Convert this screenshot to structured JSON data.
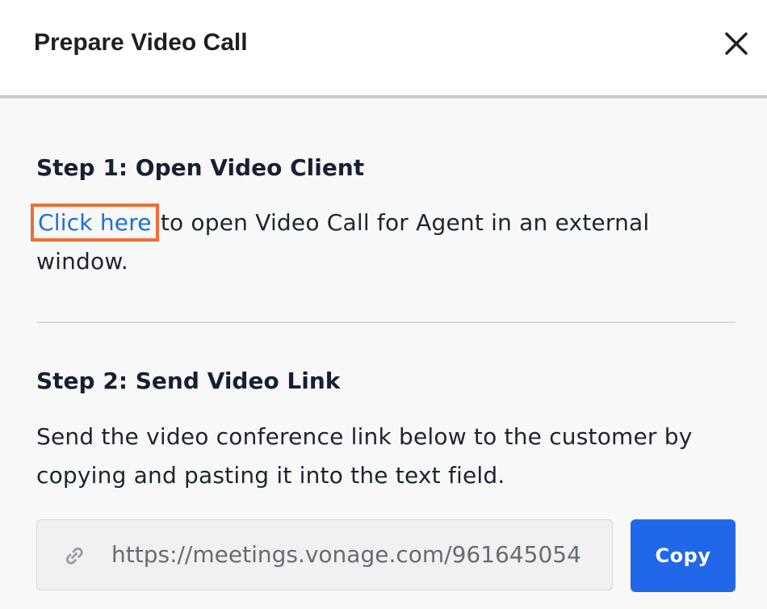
{
  "header": {
    "title": "Prepare Video Call",
    "close_icon": "close-icon"
  },
  "step1": {
    "heading": "Step 1: Open Video Client",
    "link_label": "Click here",
    "text_after_link": " to open Video Call for Agent in an external window.",
    "highlight_color": "#f26b36",
    "link_color": "#1a6fe0"
  },
  "step2": {
    "heading": "Step 2: Send Video Link",
    "description": "Send the video conference link below to the customer by copying and pasting it into the text field.",
    "link_field": {
      "icon": "link-icon",
      "value": "https://meetings.vonage.com/961645054"
    },
    "copy_label": "Copy",
    "accent_color": "#2168e8"
  }
}
